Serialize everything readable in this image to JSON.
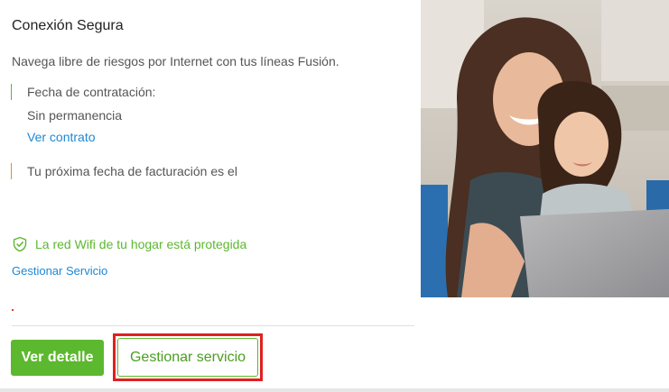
{
  "service": {
    "title": "Conexión Segura",
    "description": "Navega libre de riesgos por Internet con tus líneas Fusión.",
    "contract_label": "Fecha de contratación:",
    "permanence": "Sin permanencia",
    "view_contract_link": "Ver contrato",
    "billing_label": "Tu próxima fecha de facturación es el",
    "protected_status": "La red Wifi de tu hogar está protegida",
    "manage_link": "Gestionar Servicio"
  },
  "actions": {
    "details_button": "Ver detalle",
    "manage_button": "Gestionar servicio"
  },
  "image": {
    "description": "Mother and daughter smiling while using a laptop"
  },
  "icons": {
    "protected": "shield-check-icon"
  },
  "colors": {
    "brand_green": "#5cb82e",
    "link_blue": "#1e88d4",
    "highlight_red": "#e02020",
    "billing_accent": "#e68a2e"
  }
}
